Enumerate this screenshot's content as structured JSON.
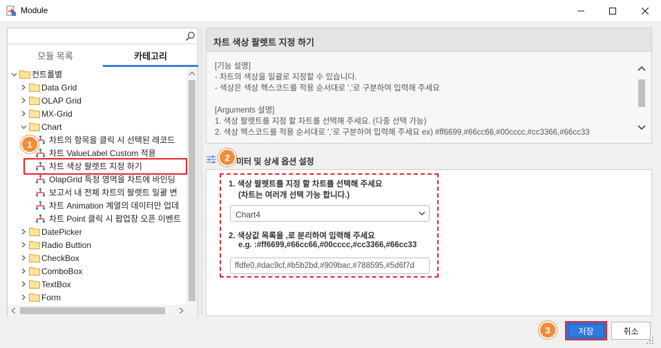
{
  "window": {
    "title": "Module",
    "minimize_glyph": "—",
    "maximize_glyph": "☐",
    "close_glyph": "✕"
  },
  "search": {
    "placeholder": "",
    "value": ""
  },
  "tabs": [
    {
      "label": "모듈 목록",
      "active": false
    },
    {
      "label": "카테고리",
      "active": true
    }
  ],
  "tree": {
    "root": "컨트롤별",
    "folders_before": [
      "Data Grid",
      "OLAP Grid",
      "MX-Grid"
    ],
    "chart_folder": "Chart",
    "chart_items": [
      "차트의 항목을 클릭 시 선택된 레코드",
      "차트 ValueLabel Custom 적용",
      "차트 색상 팔렛트 지정 하기",
      "OlapGrid 특정 영역을 차트에 바인딩",
      "보고서 내 전체 차트의 팔렛트 일괄 변",
      "차트 Animation 계열의 데이터만 업데",
      "차트 Point 클릭 시 팝업창 오픈 이벤트"
    ],
    "folders_after": [
      "DatePicker",
      "Radio Buttion",
      "CheckBox",
      "ComboBox",
      "TextBox",
      "Form"
    ],
    "selected_index": 2
  },
  "detail": {
    "title": "차트 색상 팔렛트 지정 하기",
    "description_lines": [
      "[기능 설명]",
      "  - 차트의 색상을 일괄로 지정할 수 있습니다.",
      "  - 색상은 색상 헥스코드를 적용 순서대로 ','로 구분하여 입력해 주세요",
      "",
      "[Arguments 설명]",
      "  1. 색상 팔렛트를 지정 할 차트를 선택해 주세요. (다중 선택 가능)",
      "  2. 색상 헥스코드를 적용 순서대로 ','로 구분하여 입력해 주세요 ex) #ff6699,#66cc66,#00cccc,#cc3366,#66cc33"
    ]
  },
  "params": {
    "header": "미터 및 상세 옵션 설정",
    "p1_label_line1": "1. 색상 팔렛트를 지정 할 차트를 선택해 주세요",
    "p1_label_line2": "(차트는 여러개 선택 가능 합니다.)",
    "p1_value": "Chart4",
    "p2_label_line1": "2. 색상값 목록을 ,로 분리하여 입력해 주세요",
    "p2_label_line2": "e.g. :#ff6699,#66cc66,#00cccc,#cc3366,#66cc33",
    "p2_value": "ffdfe0,#dac9cf,#b5b2bd,#909bac,#788595,#5d6f7d"
  },
  "buttons": {
    "save": "저장",
    "cancel": "취소"
  },
  "callouts": [
    "1",
    "2",
    "3"
  ],
  "colors": {
    "accent": "#2f79df",
    "highlight": "#e0262c",
    "callout": "#f08c3c",
    "folder": "#f5c342"
  }
}
